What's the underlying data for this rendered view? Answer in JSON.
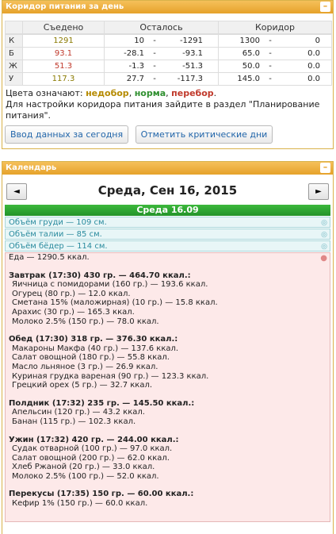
{
  "corridor": {
    "title": "Коридор питания за день",
    "collapse": "–",
    "headers": [
      "",
      "Съедено",
      "Осталось",
      "Коридор"
    ],
    "rows": [
      {
        "label": "К",
        "eaten": "1291",
        "eaten_color": "#8a7a00",
        "rem_a": "10",
        "rem_dash": "-",
        "rem_b": "-1291",
        "cor_a": "1300",
        "cor_dash": "-",
        "cor_b": "0"
      },
      {
        "label": "Б",
        "eaten": "93.1",
        "eaten_color": "#c0392b",
        "rem_a": "-28.1",
        "rem_dash": "-",
        "rem_b": "-93.1",
        "cor_a": "65.0",
        "cor_dash": "-",
        "cor_b": "0.0"
      },
      {
        "label": "Ж",
        "eaten": "51.3",
        "eaten_color": "#c0392b",
        "rem_a": "-1.3",
        "rem_dash": "-",
        "rem_b": "-51.3",
        "cor_a": "50.0",
        "cor_dash": "-",
        "cor_b": "0.0"
      },
      {
        "label": "У",
        "eaten": "117.3",
        "eaten_color": "#8a7a00",
        "rem_a": "27.7",
        "rem_dash": "-",
        "rem_b": "-117.3",
        "cor_a": "145.0",
        "cor_dash": "-",
        "cor_b": "0.0"
      }
    ],
    "legend_prefix": "Цвета означают: ",
    "legend_low": "недобор",
    "legend_sep1": ", ",
    "legend_ok": "норма",
    "legend_sep2": ", ",
    "legend_high": "перебор",
    "legend_end": ".",
    "settings_note": "Для настройки коридора питания зайдите в раздел \"Планирование питания\".",
    "btn_enter": "Ввод данных за сегодня",
    "btn_critical": "Отметить критические дни"
  },
  "calendar": {
    "title": "Календарь",
    "collapse": "–",
    "prev": "◄",
    "next": "►",
    "date": "Среда, Сен 16, 2015",
    "day_head": "Среда 16.09",
    "measures": [
      "Объём груди — 109 см.",
      "Объём талии — 85 см.",
      "Объём бёдер — 114 см."
    ],
    "food_total": "Еда — 1290.5 ккал.",
    "meals": [
      {
        "title": "Завтрак (17:30) 430 гр. — 464.70 ккал.:",
        "items": [
          "Яичница с помидорами (160 гр.) — 193.6 ккал.",
          "Огурец (80 гр.) — 12.0 ккал.",
          "Сметана 15% (маложирная) (10 гр.) — 15.8 ккал.",
          "Арахис (30 гр.) — 165.3 ккал.",
          "Молоко 2.5% (150 гр.) — 78.0 ккал."
        ]
      },
      {
        "title": "Обед (17:30) 318 гр. — 376.30 ккал.:",
        "items": [
          "Макароны Макфа (40 гр.) — 137.6 ккал.",
          "Салат овощной (180 гр.) — 55.8 ккал.",
          "Масло льняное (3 гр.) — 26.9 ккал.",
          "Куриная грудка вареная (90 гр.) — 123.3 ккал.",
          "Грецкий орех (5 гр.) — 32.7 ккал."
        ]
      },
      {
        "title": "Полдник (17:32) 235 гр. — 145.50 ккал.:",
        "items": [
          "Апельсин (120 гр.) — 43.2 ккал.",
          "Банан (115 гр.) — 102.3 ккал."
        ]
      },
      {
        "title": "Ужин (17:32) 420 гр. — 244.00 ккал.:",
        "items": [
          "Судак отварной (100 гр.) — 97.0 ккал.",
          "Салат овощной (200 гр.) — 62.0 ккал.",
          "Хлеб Ржаной (20 гр.) — 33.0 ккал.",
          "Молоко 2.5% (100 гр.) — 52.0 ккал."
        ]
      },
      {
        "title": "Перекусы (17:35) 150 гр. — 60.00 ккал.:",
        "items": [
          "Кефир 1% (150 гр.) — 60.0 ккал."
        ]
      }
    ]
  }
}
